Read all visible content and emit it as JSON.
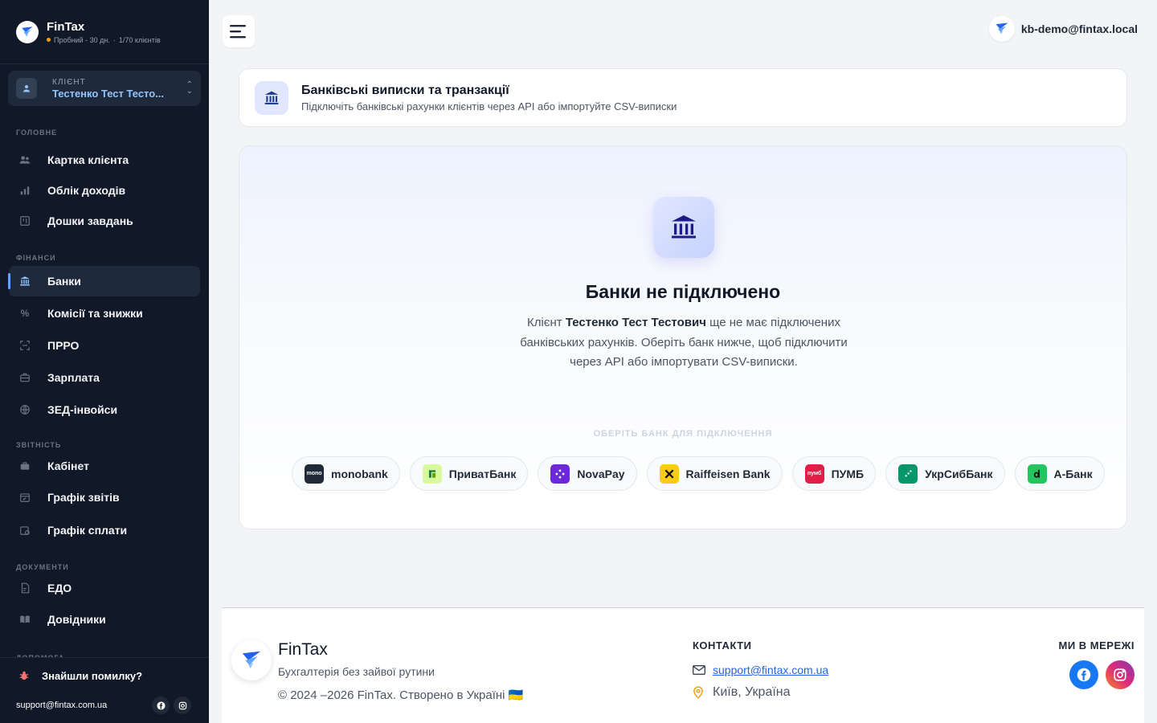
{
  "app": {
    "name": "FinTax",
    "status_line": "Пробний - 30 дн.",
    "clients_count": "1/70 клієнтів"
  },
  "client_selector": {
    "label": "КЛІЄНТ",
    "value": "Тестенко Тест Тесто..."
  },
  "sidebar": {
    "sections": [
      {
        "title": "ГОЛОВНЕ"
      },
      {
        "title": "ФІНАНСИ"
      },
      {
        "title": "ЗВІТНІСТЬ"
      },
      {
        "title": "ДОКУМЕНТИ"
      },
      {
        "title": "ДОПОМОГА"
      }
    ],
    "items": [
      {
        "label": "Картка клієнта",
        "icon": "users-icon"
      },
      {
        "label": "Облік доходів",
        "icon": "bar-chart-icon"
      },
      {
        "label": "Дошки завдань",
        "icon": "kanban-icon"
      },
      {
        "label": "Банки",
        "icon": "bank-icon",
        "active": true
      },
      {
        "label": "Комісії та знижки",
        "icon": "percent-icon"
      },
      {
        "label": "ПРРО",
        "icon": "qr-scan-icon"
      },
      {
        "label": "Зарплата",
        "icon": "briefcase-icon"
      },
      {
        "label": "ЗЕД-інвойси",
        "icon": "globe-icon"
      },
      {
        "label": "Кабінет",
        "icon": "briefcase-icon"
      },
      {
        "label": "Графік звітів",
        "icon": "calendar-check-icon"
      },
      {
        "label": "Графік сплати",
        "icon": "calendar-money-icon"
      },
      {
        "label": "ЕДО",
        "icon": "document-sign-icon"
      },
      {
        "label": "Довідники",
        "icon": "book-icon"
      }
    ],
    "bug_report": "Знайшли помилку?",
    "support_email": "support@fintax.com.ua"
  },
  "topbar": {
    "user_email": "kb-demo@fintax.local"
  },
  "page_header": {
    "title": "Банківські виписки та транзакції",
    "subtitle": "Підключіть банківські рахунки клієнтів через API або імпортуйте CSV-виписки"
  },
  "empty_state": {
    "title": "Банки не підключено",
    "desc_prefix": "Клієнт ",
    "client_name": "Тестенко Тест Тестович",
    "desc_suffix": " ще не має підключених банківських рахунків. Оберіть банк нижче, щоб підключити через API або імпортувати CSV-виписки.",
    "pick_label": "ОБЕРІТЬ БАНК ДЛЯ ПІДКЛЮЧЕННЯ"
  },
  "banks": [
    {
      "name": "monobank",
      "logo_text": "mono",
      "color": "#1f2937"
    },
    {
      "name": "ПриватБанк",
      "logo_text": "",
      "color": "#d9f99d"
    },
    {
      "name": "NovaPay",
      "logo_text": "",
      "color": "#6d28d9"
    },
    {
      "name": "Raiffeisen Bank",
      "logo_text": "",
      "color": "#facc15"
    },
    {
      "name": "ПУМБ",
      "logo_text": "пумб",
      "color": "#e11d48"
    },
    {
      "name": "УкрСибБанк",
      "logo_text": "",
      "color": "#059669"
    },
    {
      "name": "А-Банк",
      "logo_text": "",
      "color": "#22c55e"
    }
  ],
  "footer": {
    "brand": "FinTax",
    "tagline": "Бухгалтерія без зайвої рутини",
    "copyright": "© 2024 –2026 FinTax. Створено в Україні 🇺🇦",
    "contacts_title": "КОНТАКТИ",
    "email": "support@fintax.com.ua",
    "city": "Київ, Україна",
    "social_title": "МИ В МЕРЕЖІ"
  },
  "colors": {
    "sidebar_bg": "#111827",
    "accent": "#2563eb",
    "active_indicator": "#60a5fa",
    "facebook": "#1877f2",
    "instagram_from": "#f58529",
    "instagram_to": "#833ab4"
  }
}
